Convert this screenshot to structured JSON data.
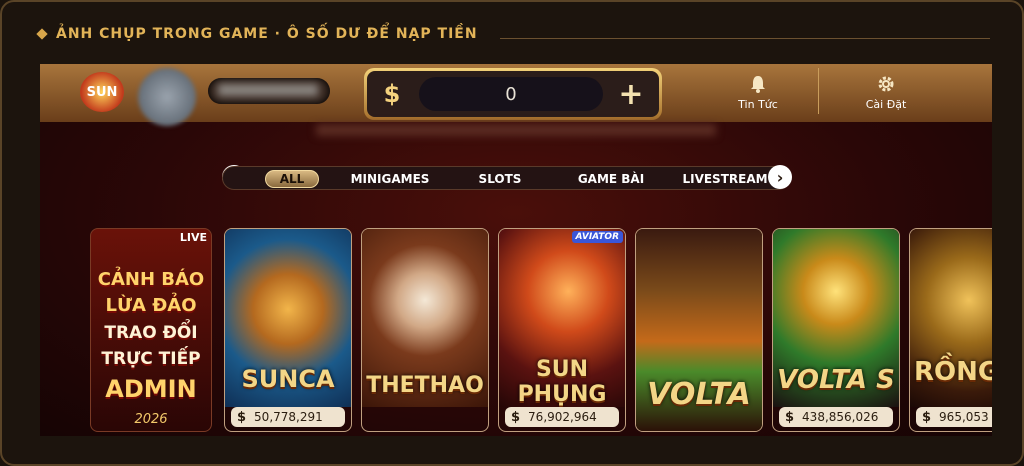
{
  "caption": "ẢNH CHỤP TRONG GAME · Ô SỐ DƯ ĐỂ NẠP TIỀN",
  "brand": {
    "logo_text": "SUN"
  },
  "header": {
    "balance_symbol": "$",
    "balance_value": "0",
    "add_symbol": "+",
    "news_label": "Tin Tức",
    "settings_label": "Cài Đặt"
  },
  "tabs": [
    "ALL",
    "MINIGAMES",
    "SLOTS",
    "GAME BÀI",
    "LIVESTREAM"
  ],
  "active_tab": "ALL",
  "nav": {
    "prev": "‹",
    "next": "›"
  },
  "warning_card": {
    "live": "LIVE",
    "lines": [
      "CẢNH BÁO",
      "LỪA ĐẢO",
      "TRAO ĐỔI",
      "TRỰC TIẾP",
      "ADMIN"
    ],
    "year": "2026"
  },
  "games": [
    {
      "title": "SUNCA",
      "amount": "50,778,291",
      "currency": "$"
    },
    {
      "title": "THETHAO",
      "amount": "",
      "currency": ""
    },
    {
      "title": "SUN PHỤNG",
      "amount": "76,902,964",
      "currency": "$",
      "badge": "AVIATOR"
    },
    {
      "title": "VOLTA",
      "amount": "",
      "currency": ""
    },
    {
      "title": "VOLTA S",
      "amount": "438,856,026",
      "currency": "$"
    },
    {
      "title": "RỒNG",
      "amount": "965,053",
      "currency": "$"
    }
  ],
  "colors": {
    "accent": "#e2b458",
    "panel": "#1c140d",
    "screen": "#2a0707"
  }
}
